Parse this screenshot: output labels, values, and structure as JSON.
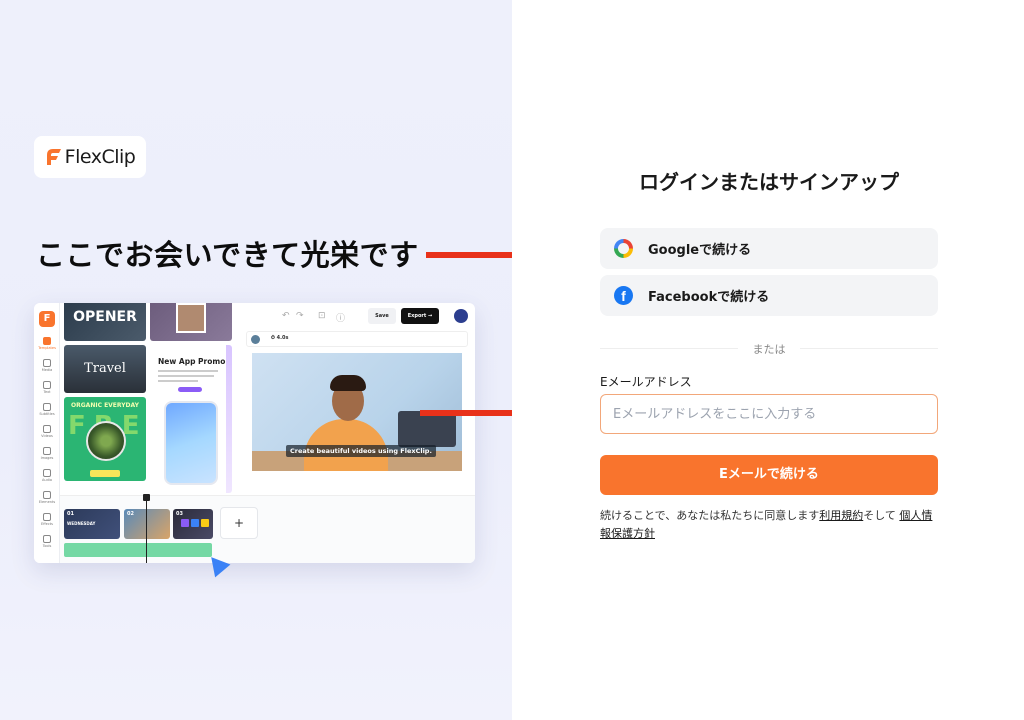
{
  "brand": {
    "logo_text": "FlexClip",
    "accent": "#f9742d"
  },
  "headline": "ここでお会いできて光栄です",
  "editor": {
    "sidebar": [
      "Templates",
      "Media",
      "Text",
      "Subtitles",
      "Videos",
      "Images",
      "Audio",
      "Elements",
      "Effects",
      "Tools"
    ],
    "templates": {
      "opener": "OPENER",
      "travel": "Travel",
      "promo_title": "New App Promo",
      "organic": "ORGANIC EVERYDAY",
      "fresh": "FRESH"
    },
    "toolbar": {
      "save": "Save",
      "export": "Export →"
    },
    "duration": "4.0s",
    "caption": "Create beautiful videos using FlexClip.",
    "clips": [
      "01",
      "02",
      "03"
    ],
    "clip1_title": "WEDNESDAY",
    "add": "+"
  },
  "login": {
    "title": "ログインまたはサインアップ",
    "google": "Googleで続ける",
    "facebook": "Facebookで続ける",
    "divider": "または",
    "email_label": "Eメールアドレス",
    "email_placeholder": "Eメールアドレスをここに入力する",
    "submit": "Eメールで続ける",
    "terms_prefix": "続けることで、あなたは私たちに同意します",
    "terms_link": "利用規約",
    "terms_middle": "そして",
    "privacy_link": "個人情報保護方針"
  },
  "colors": {
    "arrow": "#e8311a",
    "google_bg": "#f3f4f6",
    "facebook": "#1877f2"
  }
}
